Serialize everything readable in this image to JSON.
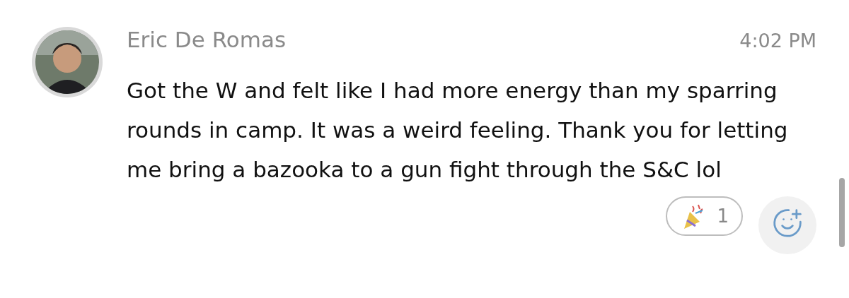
{
  "message": {
    "author": "Eric De Romas",
    "time": "4:02 PM",
    "text": "Got the W and felt like I had more energy than my sparring rounds in camp. It was a weird feeling. Thank you for letting me bring a bazooka to a gun fight through the S&C lol",
    "reactions": [
      {
        "kind": "party",
        "count": "1"
      }
    ]
  }
}
